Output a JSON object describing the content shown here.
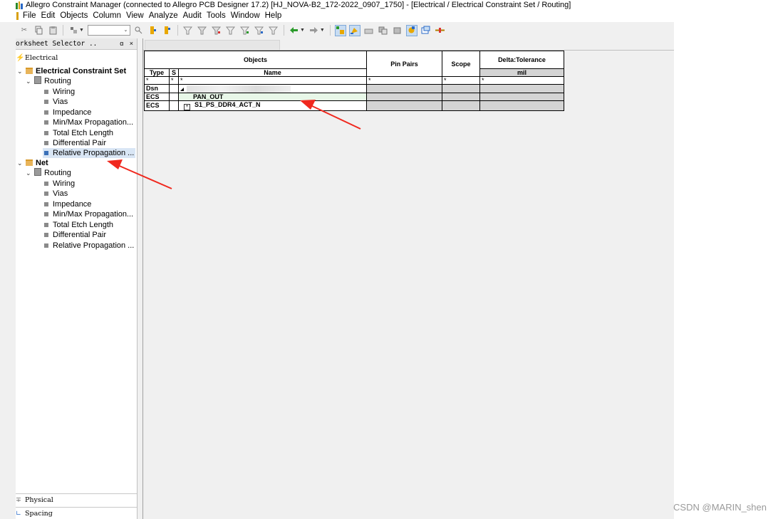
{
  "window": {
    "title": "Allegro Constraint Manager (connected to Allegro PCB Designer 17.2) [HJ_NOVA-B2_172-2022_0907_1750] - [Electrical / Electrical Constraint Set / Routing]"
  },
  "menu": {
    "items": [
      "File",
      "Edit",
      "Objects",
      "Column",
      "View",
      "Analyze",
      "Audit",
      "Tools",
      "Window",
      "Help"
    ]
  },
  "worksheet_selector": {
    "title": "orksheet Selector ..",
    "buttons": "ɑ ×",
    "electrical_tab": "Electrical",
    "tree": {
      "ecs_label": "Electrical Constraint Set",
      "ecs_routing": "Routing",
      "ecs_items": [
        "Wiring",
        "Vias",
        "Impedance",
        "Min/Max Propagation...",
        "Total Etch Length",
        "Differential Pair",
        "Relative Propagation ..."
      ],
      "net_label": "Net",
      "net_routing": "Routing",
      "net_items": [
        "Wiring",
        "Vias",
        "Impedance",
        "Min/Max Propagation...",
        "Total Etch Length",
        "Differential Pair",
        "Relative Propagation ..."
      ]
    },
    "physical_tab": "Physical",
    "spacing_tab": "Spacing"
  },
  "grid": {
    "headers": {
      "objects": "Objects",
      "type": "Type",
      "s": "S",
      "name": "Name",
      "pin_pairs": "Pin Pairs",
      "scope": "Scope",
      "delta_tolerance": "Delta:Tolerance",
      "unit": "mil"
    },
    "filter": "*",
    "rows": [
      {
        "type": "Dsn",
        "name": ""
      },
      {
        "type": "ECS",
        "name": "PAN_OUT"
      },
      {
        "type": "ECS",
        "name": "S1_PS_DDR4_ACT_N"
      }
    ]
  },
  "watermark": "CSDN @MARIN_shen"
}
